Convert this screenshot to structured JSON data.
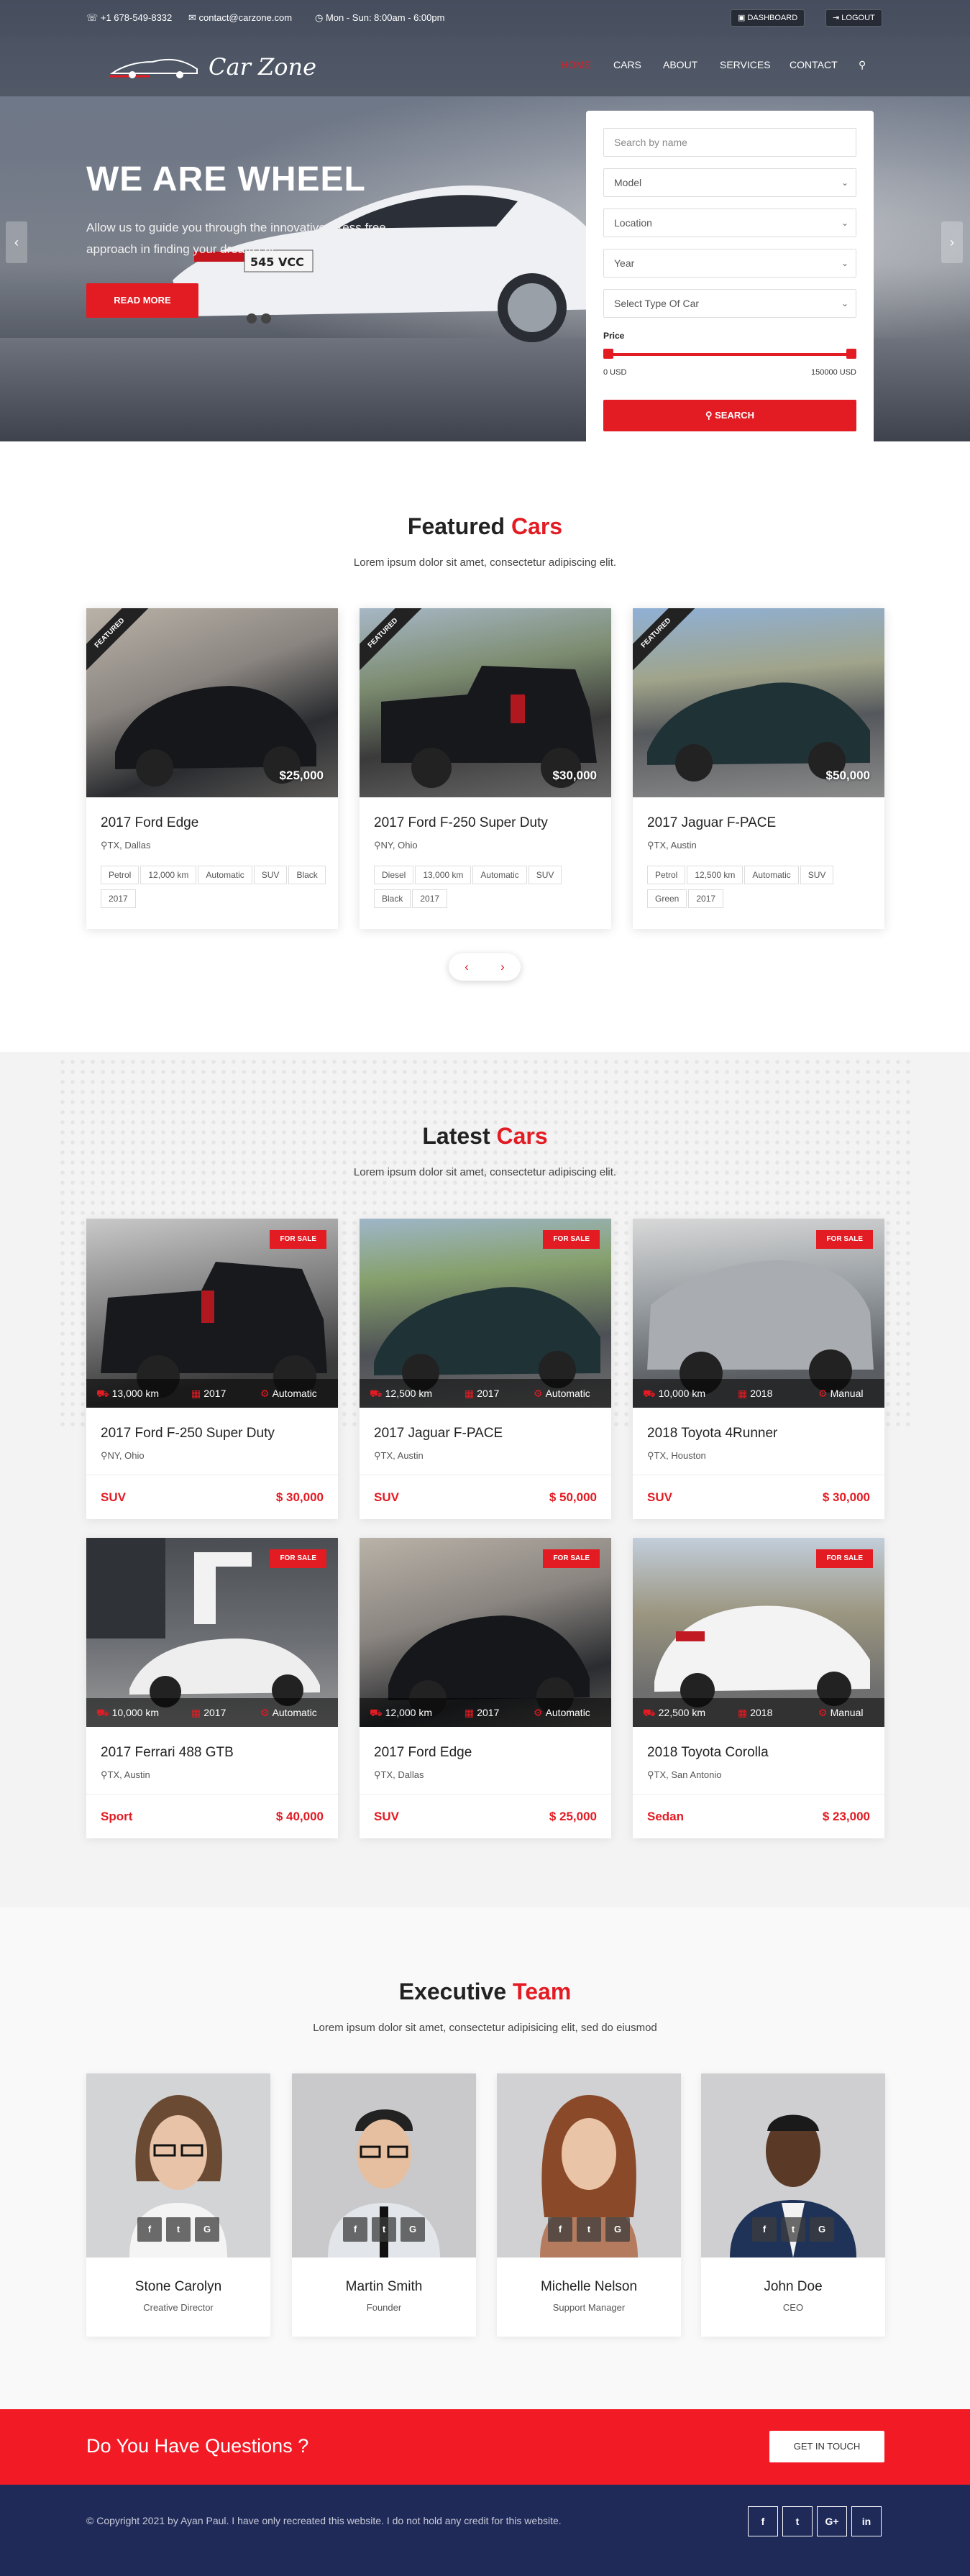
{
  "topbar": {
    "phone": "+1 678-549-8332",
    "email": "contact@carzone.com",
    "hours": "Mon - Sun: 8:00am - 6:00pm",
    "dashboard_label": "DASHBOARD",
    "logout_label": "LOGOUT"
  },
  "nav": {
    "logo_text": "Car Zone",
    "items": [
      {
        "label": "HOME",
        "active": true
      },
      {
        "label": "CARS",
        "active": false
      },
      {
        "label": "ABOUT",
        "active": false
      },
      {
        "label": "SERVICES",
        "active": false
      },
      {
        "label": "CONTACT",
        "active": false
      }
    ]
  },
  "hero": {
    "title": "WE ARE WHEEL",
    "subtitle": "Allow us to guide you through the innovative stress free approach in finding your dream car.",
    "button": "READ MORE",
    "plate": "545 VCC"
  },
  "search": {
    "name_placeholder": "Search by name",
    "model": "Model",
    "location": "Location",
    "year": "Year",
    "type": "Select Type Of Car",
    "price_label": "Price",
    "price_min": "0 USD",
    "price_max": "150000 USD",
    "button": "SEARCH"
  },
  "featured": {
    "title_main": "Featured ",
    "title_accent": "Cars",
    "subtitle": "Lorem ipsum dolor sit amet, consectetur adipiscing elit.",
    "ribbon": "FEATURED",
    "cars": [
      {
        "name": "2017 Ford Edge",
        "location": "TX, Dallas",
        "price": "$25,000",
        "tags": [
          "Petrol",
          "12,000 km",
          "Automatic",
          "SUV",
          "Black",
          "2017"
        ]
      },
      {
        "name": "2017 Ford F-250 Super Duty",
        "location": "NY, Ohio",
        "price": "$30,000",
        "tags": [
          "Diesel",
          "13,000 km",
          "Automatic",
          "SUV",
          "Black",
          "2017"
        ]
      },
      {
        "name": "2017 Jaguar F-PACE",
        "location": "TX, Austin",
        "price": "$50,000",
        "tags": [
          "Petrol",
          "12,500 km",
          "Automatic",
          "SUV",
          "Green",
          "2017"
        ]
      }
    ]
  },
  "latest": {
    "title_main": "Latest ",
    "title_accent": "Cars",
    "subtitle": "Lorem ipsum dolor sit amet, consectetur adipiscing elit.",
    "sale_label": "FOR SALE",
    "cars": [
      {
        "name": "2017 Ford F-250 Super Duty",
        "location": "NY, Ohio",
        "km": "13,000 km",
        "year": "2017",
        "trans": "Automatic",
        "type": "SUV",
        "price": "$ 30,000"
      },
      {
        "name": "2017 Jaguar F-PACE",
        "location": "TX, Austin",
        "km": "12,500 km",
        "year": "2017",
        "trans": "Automatic",
        "type": "SUV",
        "price": "$ 50,000"
      },
      {
        "name": "2018 Toyota 4Runner",
        "location": "TX, Houston",
        "km": "10,000 km",
        "year": "2018",
        "trans": "Manual",
        "type": "SUV",
        "price": "$ 30,000"
      },
      {
        "name": "2017 Ferrari 488 GTB",
        "location": "TX, Austin",
        "km": "10,000 km",
        "year": "2017",
        "trans": "Automatic",
        "type": "Sport",
        "price": "$ 40,000"
      },
      {
        "name": "2017 Ford Edge",
        "location": "TX, Dallas",
        "km": "12,000 km",
        "year": "2017",
        "trans": "Automatic",
        "type": "SUV",
        "price": "$ 25,000"
      },
      {
        "name": "2018 Toyota Corolla",
        "location": "TX, San Antonio",
        "km": "22,500 km",
        "year": "2018",
        "trans": "Manual",
        "type": "Sedan",
        "price": "$ 23,000"
      }
    ]
  },
  "team": {
    "title_main": "Executive ",
    "title_accent": "Team",
    "subtitle": "Lorem ipsum dolor sit amet, consectetur adipisicing elit, sed do eiusmod",
    "social_icons": [
      "f",
      "t",
      "G"
    ],
    "members": [
      {
        "name": "Stone Carolyn",
        "role": "Creative Director"
      },
      {
        "name": "Martin Smith",
        "role": "Founder"
      },
      {
        "name": "Michelle Nelson",
        "role": "Support Manager"
      },
      {
        "name": "John Doe",
        "role": "CEO"
      }
    ]
  },
  "cta": {
    "question": "Do You Have Questions ?",
    "button": "GET IN TOUCH"
  },
  "footer": {
    "copyright": "© Copyright 2021 by Ayan Paul. I have only recreated this website. I do not hold any credit for this website.",
    "socials": [
      "f",
      "t",
      "G+",
      "in"
    ]
  },
  "colors": {
    "accent": "#e31b23",
    "footer": "#1f2a59",
    "cta": "#f11a25"
  }
}
